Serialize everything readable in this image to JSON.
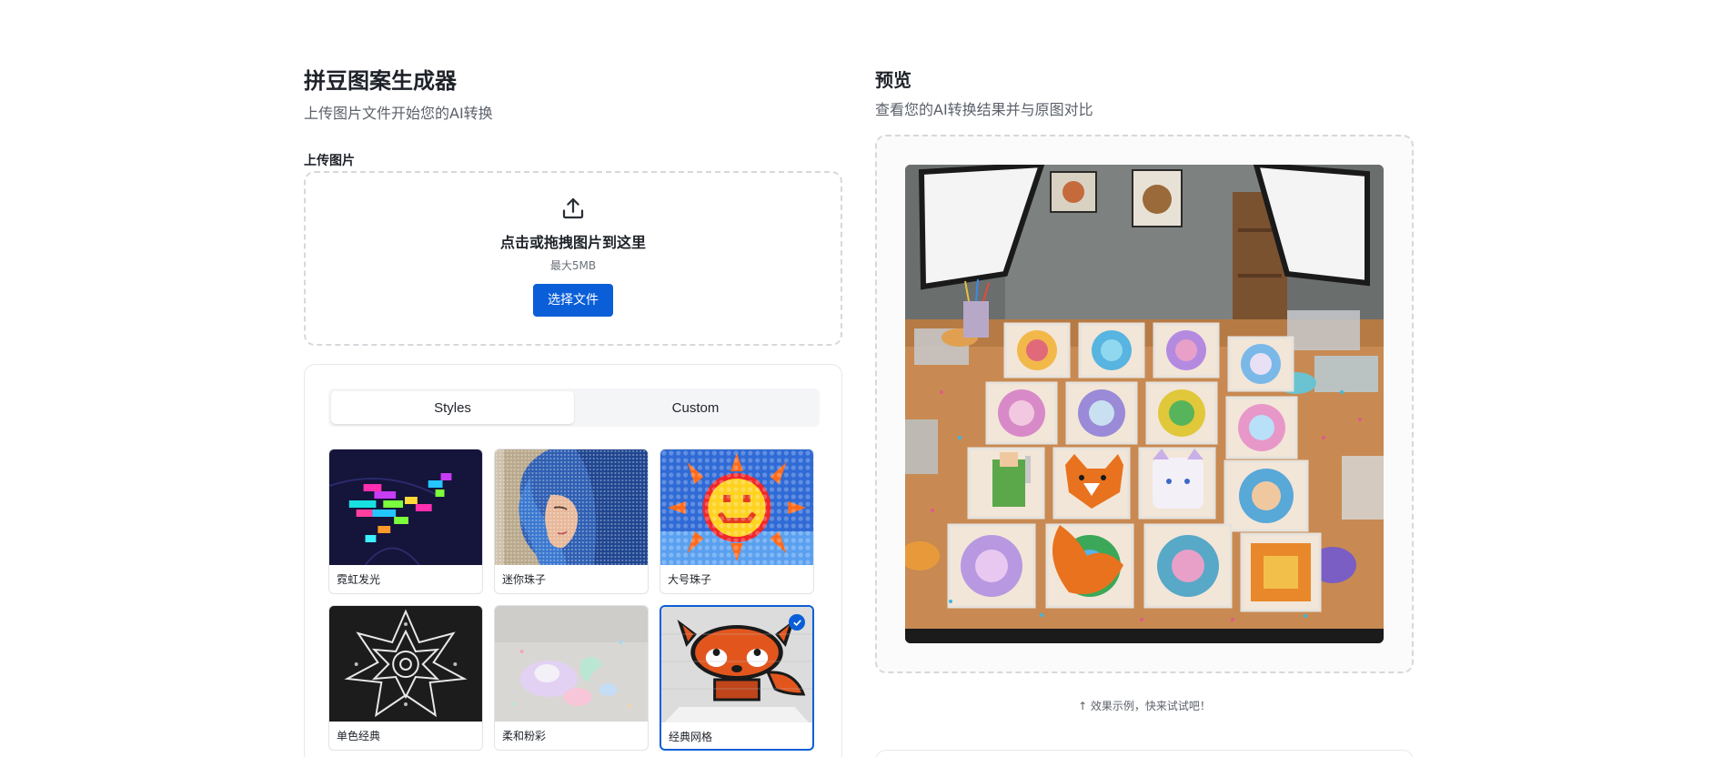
{
  "generator": {
    "title": "拼豆图案生成器",
    "subtitle": "上传图片文件开始您的AI转换"
  },
  "upload": {
    "label": "上传图片",
    "prompt": "点击或拖拽图片到这里",
    "hint": "最大5MB",
    "button": "选择文件",
    "icon": "upload-icon"
  },
  "tabs": [
    {
      "label": "Styles",
      "active": true
    },
    {
      "label": "Custom",
      "active": false
    }
  ],
  "styles": [
    {
      "label": "霓虹发光",
      "selected": false
    },
    {
      "label": "迷你珠子",
      "selected": false
    },
    {
      "label": "大号珠子",
      "selected": false
    },
    {
      "label": "单色经典",
      "selected": false
    },
    {
      "label": "柔和粉彩",
      "selected": false
    },
    {
      "label": "经典网格",
      "selected": true
    }
  ],
  "preview": {
    "title": "预览",
    "subtitle": "查看您的AI转换结果并与原图对比",
    "note": "↑ 效果示例，快来试试吧！"
  },
  "colors": {
    "accent": "#0a5fd8",
    "border": "#d6d8dc",
    "text": "#1f2329",
    "muted": "#5b6069"
  }
}
